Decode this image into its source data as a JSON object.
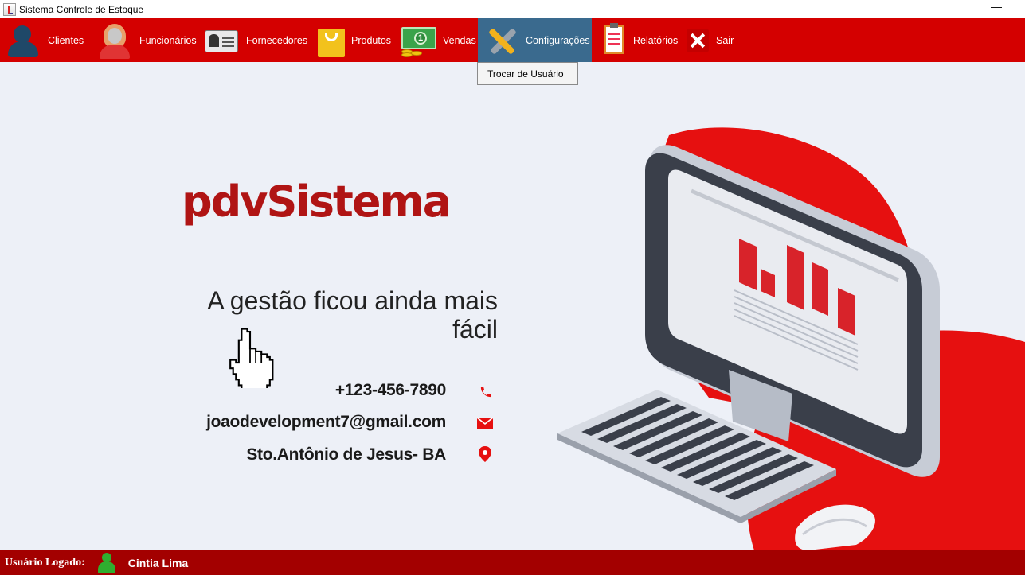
{
  "window": {
    "title": "Sistema Controle de Estoque",
    "minimize_label": "—"
  },
  "menu": {
    "items": [
      {
        "label": "Clientes",
        "icon": "person-icon"
      },
      {
        "label": "Funcionários",
        "icon": "woman-icon"
      },
      {
        "label": "Fornecedores",
        "icon": "id-card-icon"
      },
      {
        "label": "Produtos",
        "icon": "shopping-bag-icon"
      },
      {
        "label": "Vendas",
        "icon": "money-icon"
      },
      {
        "label": "Configurações",
        "icon": "tools-icon",
        "active": true
      },
      {
        "label": "Relatórios",
        "icon": "report-icon"
      },
      {
        "label": "Sair",
        "icon": "close-icon"
      }
    ],
    "dropdown": {
      "item": "Trocar de Usuário"
    }
  },
  "main": {
    "logo": "pdvSistema",
    "tagline_line1": "A gestão ficou ainda mais",
    "tagline_line2": "fácil",
    "phone": "+123-456-7890",
    "email": "joaodevelopment7@gmail.com",
    "address": "Sto.Antônio de Jesus- BA"
  },
  "status": {
    "label": "Usuário Logado:",
    "username": "Cintia Lima"
  },
  "colors": {
    "menu_bg": "#d40000",
    "menu_active": "#3a6a8e",
    "status_bg": "#a30000",
    "page_bg": "#edf0f7",
    "accent": "#e61010"
  }
}
